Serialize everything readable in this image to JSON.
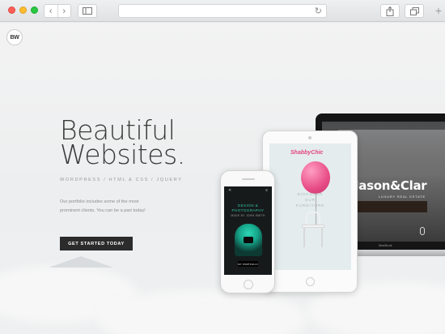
{
  "browser": {
    "back_glyph": "‹",
    "forward_glyph": "›",
    "reload_glyph": "↻",
    "new_tab_glyph": "+",
    "icons": [
      "back-icon",
      "forward-icon",
      "sidebar-icon",
      "reload-icon",
      "share-icon",
      "tabs-icon",
      "new-tab-icon"
    ]
  },
  "site": {
    "logo_text": "BW",
    "headline_line1": "Beautiful",
    "headline_line2": "Websites.",
    "tagline": "WORDPRESS / HTML & CSS / JQUERY",
    "description": "Our portfolio includes some of the most prominent clients. You can be a part today!",
    "cta_label": "GET STARTED TODAY"
  },
  "devices": {
    "macbook": {
      "brand": "Jason&Clar",
      "subtitle": "LUXURY REAL ESTATE",
      "label": "MacBook"
    },
    "ipad": {
      "logo": "ShabbyChic",
      "line1": "DISCOVER",
      "line2": "OUR",
      "line3": "FURNITURE"
    },
    "iphone": {
      "close_glyph": "✕",
      "menu_glyph": "≡",
      "title_line1": "DESIGN &",
      "title_line2": "PHOTOGRAPHY",
      "byline": "MADE BY JOHN SMITH",
      "button": "MY PORTFOLIO"
    }
  },
  "colors": {
    "cta_bg": "#2b2b2b",
    "accent_teal": "#2ec4a5",
    "accent_pink": "#e74c86"
  }
}
